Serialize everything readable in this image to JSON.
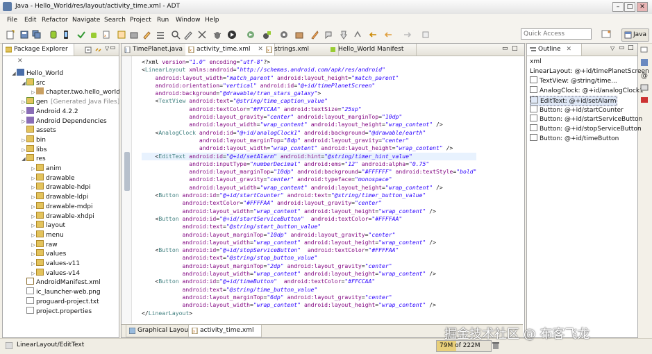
{
  "window": {
    "title": "Java - Hello_World/res/layout/activity_time.xml - ADT",
    "minimize": "–",
    "maximize": "□",
    "close": "✕"
  },
  "menu": [
    "File",
    "Edit",
    "Refactor",
    "Navigate",
    "Search",
    "Project",
    "Run",
    "Window",
    "Help"
  ],
  "toolbar": {
    "quick_access_placeholder": "Quick Access",
    "perspective_label": "Java"
  },
  "package_explorer": {
    "title": "Package Explorer",
    "tree": [
      {
        "label": "Hello_World",
        "indent": 0,
        "twisty": "◢",
        "icon": "project-icon"
      },
      {
        "label": "src",
        "indent": 1,
        "twisty": "◢",
        "icon": "source-folder-icon"
      },
      {
        "label": "chapter.two.hello_world",
        "indent": 2,
        "twisty": "▷",
        "icon": "package-icon"
      },
      {
        "label": "gen",
        "suffix": "[Generated Java Files]",
        "indent": 1,
        "twisty": "▷",
        "icon": "source-folder-icon"
      },
      {
        "label": "Android 4.2.2",
        "indent": 1,
        "twisty": "▷",
        "icon": "library-icon"
      },
      {
        "label": "Android Dependencies",
        "indent": 1,
        "twisty": "▷",
        "icon": "library-icon"
      },
      {
        "label": "assets",
        "indent": 1,
        "twisty": "",
        "icon": "folder-icon"
      },
      {
        "label": "bin",
        "indent": 1,
        "twisty": "▷",
        "icon": "folder-icon"
      },
      {
        "label": "libs",
        "indent": 1,
        "twisty": "▷",
        "icon": "folder-icon"
      },
      {
        "label": "res",
        "indent": 1,
        "twisty": "◢",
        "icon": "folder-icon"
      },
      {
        "label": "anim",
        "indent": 2,
        "twisty": "▷",
        "icon": "folder-icon"
      },
      {
        "label": "drawable",
        "indent": 2,
        "twisty": "▷",
        "icon": "folder-icon"
      },
      {
        "label": "drawable-hdpi",
        "indent": 2,
        "twisty": "▷",
        "icon": "folder-icon"
      },
      {
        "label": "drawable-ldpi",
        "indent": 2,
        "twisty": "▷",
        "icon": "folder-icon"
      },
      {
        "label": "drawable-mdpi",
        "indent": 2,
        "twisty": "▷",
        "icon": "folder-icon"
      },
      {
        "label": "drawable-xhdpi",
        "indent": 2,
        "twisty": "▷",
        "icon": "folder-icon"
      },
      {
        "label": "layout",
        "indent": 2,
        "twisty": "▷",
        "icon": "folder-icon"
      },
      {
        "label": "menu",
        "indent": 2,
        "twisty": "▷",
        "icon": "folder-icon"
      },
      {
        "label": "raw",
        "indent": 2,
        "twisty": "▷",
        "icon": "folder-icon"
      },
      {
        "label": "values",
        "indent": 2,
        "twisty": "▷",
        "icon": "folder-icon"
      },
      {
        "label": "values-v11",
        "indent": 2,
        "twisty": "▷",
        "icon": "folder-icon"
      },
      {
        "label": "values-v14",
        "indent": 2,
        "twisty": "▷",
        "icon": "folder-icon"
      },
      {
        "label": "AndroidManifest.xml",
        "indent": 1,
        "twisty": "",
        "icon": "xml-file-icon"
      },
      {
        "label": "ic_launcher-web.png",
        "indent": 1,
        "twisty": "",
        "icon": "image-file-icon"
      },
      {
        "label": "proguard-project.txt",
        "indent": 1,
        "twisty": "",
        "icon": "text-file-icon"
      },
      {
        "label": "project.properties",
        "indent": 1,
        "twisty": "",
        "icon": "properties-file-icon"
      }
    ]
  },
  "editor": {
    "tabs": [
      {
        "label": "TimePlanet.java",
        "icon": "java-file-icon",
        "active": false
      },
      {
        "label": "activity_time.xml",
        "icon": "xml-file-icon",
        "active": true
      },
      {
        "label": "strings.xml",
        "icon": "xml-file-icon",
        "active": false
      },
      {
        "label": "Hello_World Manifest",
        "icon": "manifest-icon",
        "active": false
      }
    ],
    "bottom_tabs": [
      {
        "label": "Graphical Layout",
        "icon": "layout-icon",
        "active": false
      },
      {
        "label": "activity_time.xml",
        "icon": "xml-file-icon",
        "active": true
      }
    ],
    "lines": [
      "<?xml version=\"1.0\" encoding=\"utf-8\"?>",
      "<LinearLayout xmlns:android=\"http://schemas.android.com/apk/res/android\"",
      "    android:layout_width=\"match_parent\" android:layout_height=\"match_parent\"",
      "    android:orientation=\"vertical\" android:id=\"@+id/timePlanetScreen\"",
      "    android:background=\"@drawable/tran_stars_galaxy\">",
      "    <TextView android:text=\"@string/time_caption_value\"",
      "              android:textColor=\"#FFCCAA\" android:textSize=\"25sp\"",
      "              android:layout_gravity=\"center\" android:layout_marginTop=\"10dp\"",
      "              android:layout_width=\"wrap_content\" android:layout_height=\"wrap_content\" />",
      "    <AnalogClock android:id=\"@+id/analogClock1\" android:background=\"@drawable/earth\"",
      "                 android:layout_marginTop=\"8dp\" android:layout_gravity=\"center\"",
      "                 android:layout_width=\"wrap_content\" android:layout_height=\"wrap_content\" />",
      "    <EditText android:id=\"@+id/setAlarm\" android:hint=\"@string/timer_hint_value\"",
      "              android:inputType=\"numberDecimal\" android:ems=\"12\" android:alpha=\"0.75\"",
      "              android:layout_marginTop=\"10dp\" android:background=\"#FFFFFF\" android:textStyle=\"bold\"",
      "              android:layout_gravity=\"center\" android:typeface=\"monospace\"",
      "              android:layout_width=\"wrap_content\" android:layout_height=\"wrap_content\" />",
      "    <Button android:id=\"@+id/startCounter\" android:text=\"@string/timer_button_value\"",
      "            android:textColor=\"#FFFFAA\" android:layout_gravity=\"center\"",
      "            android:layout_width=\"wrap_content\" android:layout_height=\"wrap_content\" />",
      "    <Button android:id=\"@+id/startServiceButton\"  android:textColor=\"#FFFFAA\"",
      "            android:text=\"@string/start_button_value\"",
      "            android:layout_marginTop=\"10dp\" android:layout_gravity=\"center\"",
      "            android:layout_width=\"wrap_content\" android:layout_height=\"wrap_content\" />",
      "    <Button android:id=\"@+id/stopServiceButton\"  android:textColor=\"#FFFFAA\"",
      "            android:text=\"@string/stop_button_value\"",
      "            android:layout_marginTop=\"2dp\" android:layout_gravity=\"center\"",
      "            android:layout_width=\"wrap_content\" android:layout_height=\"wrap_content\" />",
      "    <Button android:id=\"@+id/timeButton\"  android:textColor=\"#FFCCAA\"",
      "            android:text=\"@string/time_button_value\"",
      "            android:layout_marginTop=\"6dp\" android:layout_gravity=\"center\"",
      "            android:layout_width=\"wrap_content\" android:layout_height=\"wrap_content\" />",
      "</LinearLayout>"
    ],
    "highlighted_line": 12
  },
  "outline": {
    "title": "Outline",
    "items": [
      {
        "label": "xml",
        "icon": ""
      },
      {
        "label": "LinearLayout: @+id/timePlanetScreen",
        "icon": ""
      },
      {
        "label": "TextView: @string/time...",
        "icon": "Ab"
      },
      {
        "label": "AnalogClock: @+id/analogClock1",
        "icon": "clock"
      },
      {
        "label": "EditText: @+id/setAlarm",
        "icon": "I",
        "selected": true
      },
      {
        "label": "Button: @+id/startCounter",
        "icon": "btn"
      },
      {
        "label": "Button: @+id/startServiceButton",
        "icon": "btn"
      },
      {
        "label": "Button: @+id/stopServiceButton",
        "icon": "btn"
      },
      {
        "label": "Button: @+id/timeButton",
        "icon": "btn"
      }
    ]
  },
  "status": {
    "path": "LinearLayout/EditText",
    "memory": "79M of 222M"
  },
  "watermark": "掘金技术社区 @ 布客飞龙",
  "colors": {
    "tag": "#3f7f7f",
    "attribute": "#7f007f",
    "string": "#2a00ff",
    "declaration": "#3f5fbf",
    "selection": "#e8f2fe"
  }
}
